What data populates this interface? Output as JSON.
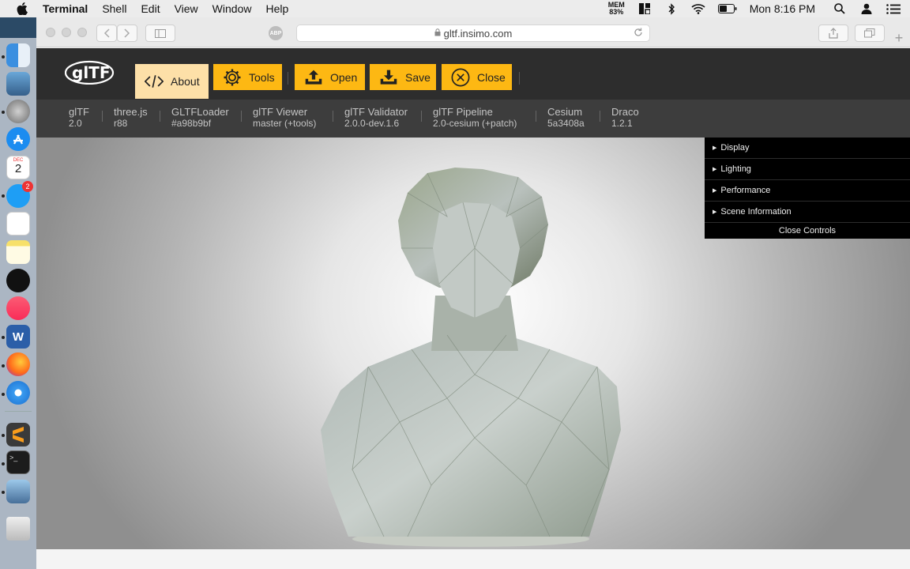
{
  "menubar": {
    "app_name": "Terminal",
    "menus": [
      "Shell",
      "Edit",
      "View",
      "Window",
      "Help"
    ],
    "mem_label": "MEM",
    "mem_value": "83%",
    "clock": "Mon 8:16 PM"
  },
  "dock": {
    "messages_badge": "2",
    "calendar_month": "DEC",
    "calendar_day": "2"
  },
  "browser": {
    "url": "gltf.insimo.com",
    "adblock_label": "ABP"
  },
  "site": {
    "logo_text": "glTF",
    "buttons": {
      "about": "About",
      "tools": "Tools",
      "open": "Open",
      "save": "Save",
      "close": "Close"
    },
    "versions": [
      {
        "name": "glTF",
        "value": "2.0"
      },
      {
        "name": "three.js",
        "value": "r88"
      },
      {
        "name": "GLTFLoader",
        "value": "#a98b9bf"
      },
      {
        "name": "glTF Viewer",
        "value": "master (+tools)"
      },
      {
        "name": "glTF Validator",
        "value": "2.0.0-dev.1.6"
      },
      {
        "name": "glTF Pipeline",
        "value": "2.0-cesium (+patch)"
      },
      {
        "name": "Cesium",
        "value": "5a3408a"
      },
      {
        "name": "Draco",
        "value": "1.2.1"
      }
    ]
  },
  "gui": {
    "folders": [
      "Display",
      "Lighting",
      "Performance",
      "Scene Information"
    ],
    "close_label": "Close Controls"
  },
  "colors": {
    "accent": "#fdb813",
    "accent_active": "#fde0a8",
    "header_bg": "#2d2d2d",
    "version_bg": "#3d3d3d"
  }
}
